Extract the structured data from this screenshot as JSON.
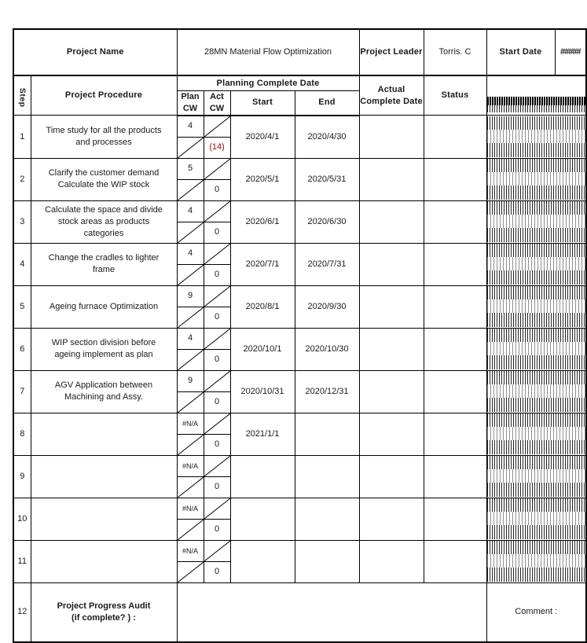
{
  "document": {
    "kind": "project-schedule-spreadsheet"
  },
  "header": {
    "project_name_label": "Project Name",
    "project_name_value": "28MN Material Flow Optimization",
    "project_leader_label": "Project Leader",
    "project_leader_value": "Torris. C",
    "start_date_label": "Start Date",
    "start_date_value": "#####"
  },
  "columns": {
    "step": "Step",
    "procedure": "Project Procedure",
    "planning_group": "Planning Complete Date",
    "plan_cw": "Plan CW",
    "act_cw": "Act CW",
    "start": "Start",
    "end": "End",
    "actual_complete": "Actual\nComplete Date",
    "actual_complete_line1": "Actual",
    "actual_complete_line2": "Complete Date",
    "status": "Status",
    "timeline": "#####"
  },
  "rows": [
    {
      "step": "1",
      "procedure_line1": "Time study for all the products",
      "procedure_line2": "and processes",
      "plan_cw": "4",
      "act_cw": "(14)",
      "act_cw_color": "#c00000",
      "start": "2020/4/1",
      "end": "2020/4/30",
      "actual_complete": "",
      "status": ""
    },
    {
      "step": "2",
      "procedure_line1": "Clarify the customer demand",
      "procedure_line2": "Calculate the WIP stock",
      "plan_cw": "5",
      "act_cw": "0",
      "act_cw_color": "#1a1a1a",
      "start": "2020/5/1",
      "end": "2020/5/31",
      "actual_complete": "",
      "status": ""
    },
    {
      "step": "3",
      "procedure_line1": "Calculate the space and divide",
      "procedure_line2": "stock areas as products",
      "procedure_line3": "categories",
      "plan_cw": "4",
      "act_cw": "0",
      "act_cw_color": "#1a1a1a",
      "start": "2020/6/1",
      "end": "2020/6/30",
      "actual_complete": "",
      "status": ""
    },
    {
      "step": "4",
      "procedure_line1": "Change the cradles to lighter",
      "procedure_line2": "frame",
      "plan_cw": "4",
      "act_cw": "0",
      "act_cw_color": "#1a1a1a",
      "start": "2020/7/1",
      "end": "2020/7/31",
      "actual_complete": "",
      "status": ""
    },
    {
      "step": "5",
      "procedure_line1": "Ageing furnace Optimization",
      "procedure_line2": "",
      "plan_cw": "9",
      "act_cw": "0",
      "act_cw_color": "#1a1a1a",
      "start": "2020/8/1",
      "end": "2020/9/30",
      "actual_complete": "",
      "status": ""
    },
    {
      "step": "6",
      "procedure_line1": "WIP section division before",
      "procedure_line2": "ageing implement  as plan",
      "plan_cw": "4",
      "act_cw": "0",
      "act_cw_color": "#1a1a1a",
      "start": "2020/10/1",
      "end": "2020/10/30",
      "actual_complete": "",
      "status": ""
    },
    {
      "step": "7",
      "procedure_line1": "AGV Application between",
      "procedure_line2": "Machining and Assy.",
      "plan_cw": "9",
      "act_cw": "0",
      "act_cw_color": "#1a1a1a",
      "start": "2020/10/31",
      "end": "2020/12/31",
      "actual_complete": "",
      "status": ""
    },
    {
      "step": "8",
      "procedure_line1": "",
      "procedure_line2": "",
      "plan_cw": "#N/A",
      "act_cw": "0",
      "act_cw_color": "#1a1a1a",
      "start": "2021/1/1",
      "end": "",
      "actual_complete": "",
      "status": ""
    },
    {
      "step": "9",
      "procedure_line1": "",
      "procedure_line2": "",
      "plan_cw": "#N/A",
      "act_cw": "0",
      "act_cw_color": "#1a1a1a",
      "start": "",
      "end": "",
      "actual_complete": "",
      "status": ""
    },
    {
      "step": "10",
      "procedure_line1": "",
      "procedure_line2": "",
      "plan_cw": "#N/A",
      "act_cw": "0",
      "act_cw_color": "#1a1a1a",
      "start": "",
      "end": "",
      "actual_complete": "",
      "status": ""
    },
    {
      "step": "11",
      "procedure_line1": "",
      "procedure_line2": "",
      "plan_cw": "#N/A",
      "act_cw": "0",
      "act_cw_color": "#1a1a1a",
      "start": "",
      "end": "",
      "actual_complete": "",
      "status": ""
    }
  ],
  "footer": {
    "step": "12",
    "audit_line1": "Project Progress Audit",
    "audit_line2": "(if complete? )  :",
    "comment_label": "Comment :"
  },
  "colors": {
    "highlight_fill": "#FDF8DC",
    "grid_line": "#000000",
    "text": "#1a1a1a",
    "alert_text": "#c00000"
  }
}
